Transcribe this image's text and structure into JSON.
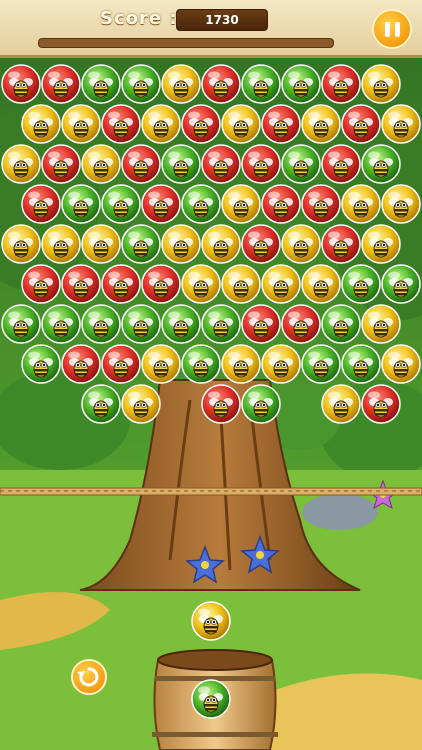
{
  "hud": {
    "score_label": "Score :",
    "score_value": "1730",
    "level_progress_fraction": 0.0
  },
  "controls": {
    "pause_icon": "pause-icon",
    "swap_icon": "swap-arrow-icon"
  },
  "colors": {
    "red": "#e0322a",
    "yellow": "#f2c21b",
    "green": "#4cb52a",
    "accent": "#f39c12"
  },
  "board": {
    "rows": [
      [
        "red",
        "red",
        "green",
        "green",
        "yellow",
        "red",
        "green",
        "green",
        "red",
        "yellow"
      ],
      [
        "yellow",
        "yellow",
        "red",
        "yellow",
        "red",
        "yellow",
        "red",
        "yellow",
        "red",
        "yellow"
      ],
      [
        "yellow",
        "red",
        "yellow",
        "red",
        "green",
        "red",
        "red",
        "green",
        "red",
        "green"
      ],
      [
        "red",
        "green",
        "green",
        "red",
        "green",
        "yellow",
        "red",
        "red",
        "yellow",
        "yellow"
      ],
      [
        "yellow",
        "yellow",
        "yellow",
        "green",
        "yellow",
        "yellow",
        "red",
        "yellow",
        "red",
        "yellow"
      ],
      [
        "red",
        "red",
        "red",
        "red",
        "yellow",
        "yellow",
        "yellow",
        "yellow",
        "green",
        "green"
      ],
      [
        "green",
        "green",
        "green",
        "green",
        "green",
        "green",
        "red",
        "red",
        "green",
        "yellow"
      ],
      [
        "green",
        "red",
        "red",
        "yellow",
        "green",
        "yellow",
        "yellow",
        "green",
        "green",
        "yellow"
      ],
      [
        "",
        "",
        "green",
        "yellow",
        "",
        "red",
        "green",
        "",
        "yellow",
        "red"
      ]
    ]
  },
  "shooter": {
    "loaded": "yellow",
    "next": "green"
  }
}
